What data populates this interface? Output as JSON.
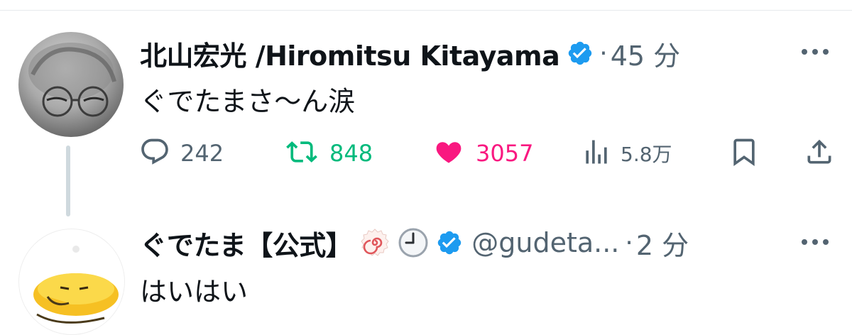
{
  "tweet1": {
    "author_name": "北山宏光 /Hiromitsu Kitayama",
    "separator": "·",
    "time": "45 分",
    "text": "ぐでたまさ〜ん涙",
    "stats": {
      "replies": "242",
      "retweets": "848",
      "likes": "3057",
      "views": "5.8万"
    },
    "colors": {
      "retweet": "#00ba7c",
      "like": "#f91880",
      "verified": "#1d9bf0"
    }
  },
  "tweet2": {
    "author_name": "ぐでたま【公式】",
    "handle": "@gudeta...",
    "separator": "·",
    "time": "2 分",
    "text": "はいはい",
    "emojis": [
      "naruto-fishcake-icon",
      "nine-oclock-icon"
    ]
  },
  "icons": [
    "reply-icon",
    "retweet-icon",
    "heart-icon",
    "views-icon",
    "bookmark-icon",
    "share-icon",
    "more-icon",
    "verified-badge-icon"
  ]
}
